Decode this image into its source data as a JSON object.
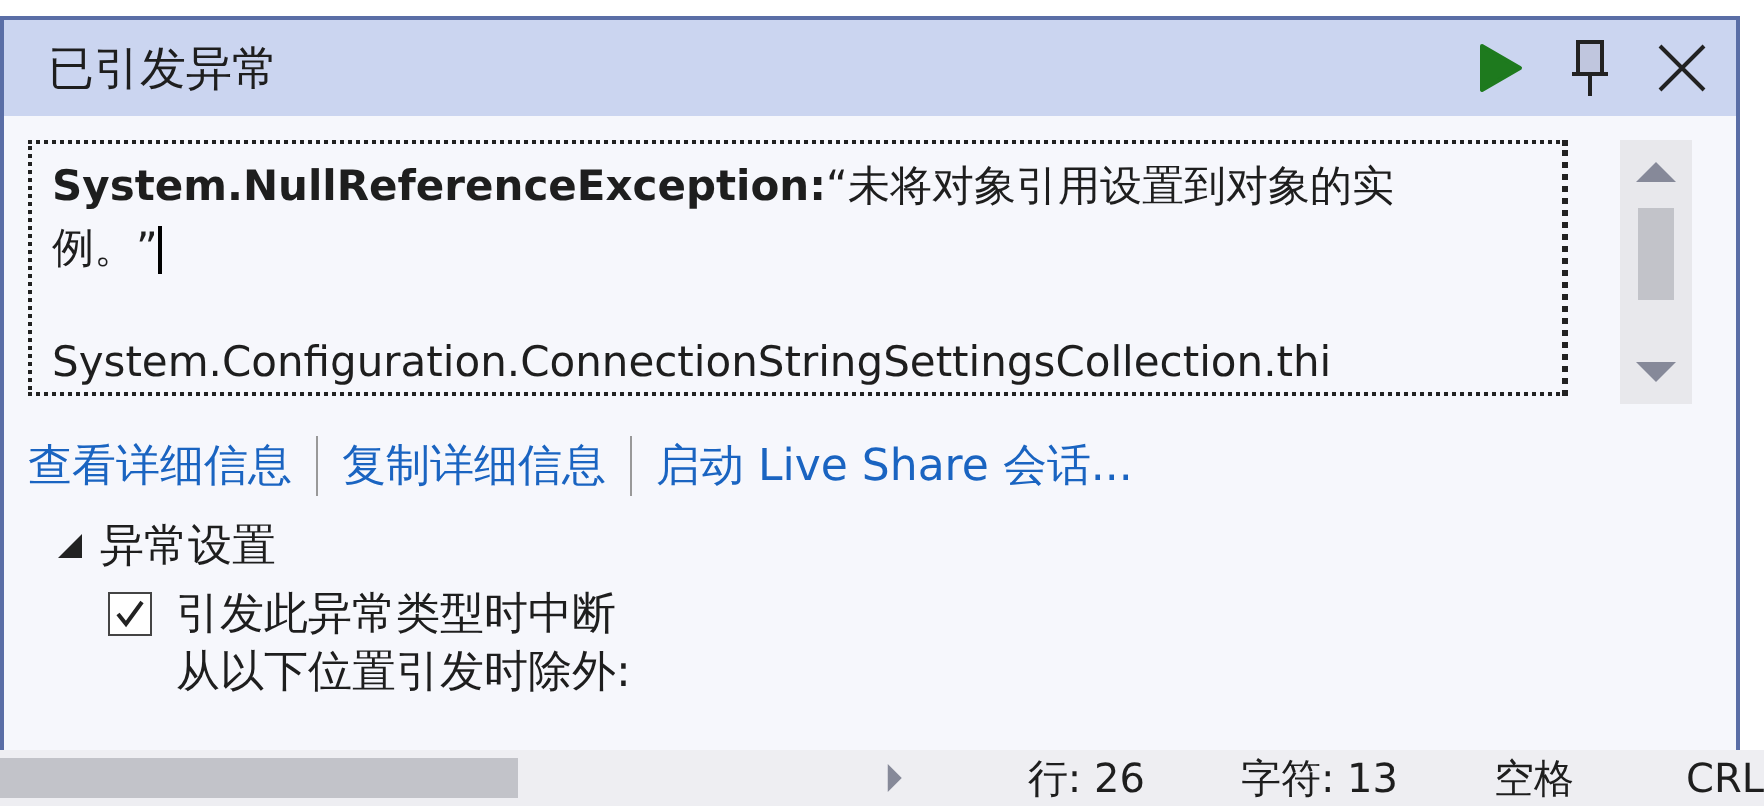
{
  "window": {
    "title": "已引发异常"
  },
  "message": {
    "exception": "System.NullReferenceException:",
    "text": "“未将对象引用设置到对象的实例。”",
    "stack_line": "System.Configuration.ConnectionStringSettingsCollection.thi"
  },
  "links": [
    "查看详细信息",
    "复制详细信息",
    "启动 Live Share 会话..."
  ],
  "settings": {
    "title": "异常设置",
    "expanded": true,
    "options": [
      {
        "label": "引发此异常类型时中断",
        "checked": true
      }
    ],
    "note": "从以下位置引发时除外:"
  },
  "status_bar": {
    "line": "行: 26",
    "char": "字符: 13",
    "indent": "空格",
    "eol": "CRL"
  }
}
